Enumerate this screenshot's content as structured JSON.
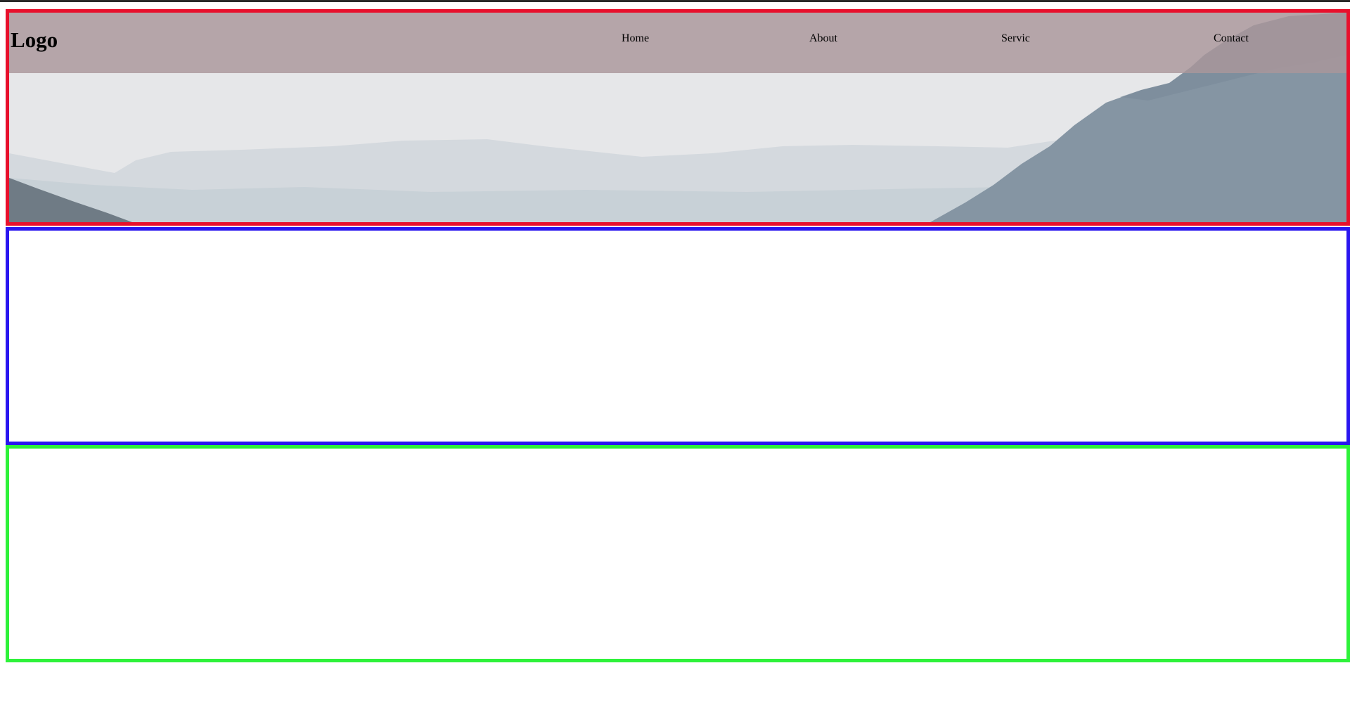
{
  "header": {
    "logo": "Logo",
    "nav": [
      {
        "label": "Home"
      },
      {
        "label": "About"
      },
      {
        "label": "Servic"
      },
      {
        "label": "Contact"
      }
    ]
  },
  "colors": {
    "hero_border": "#e8102c",
    "section2_border": "#2a16f0",
    "section3_border": "#2ef23a",
    "navbar_overlay": "#aa969b",
    "sky": "#e6e7e9",
    "mountain_near": "#8595a3"
  },
  "hero_image": "mountain-landscape"
}
